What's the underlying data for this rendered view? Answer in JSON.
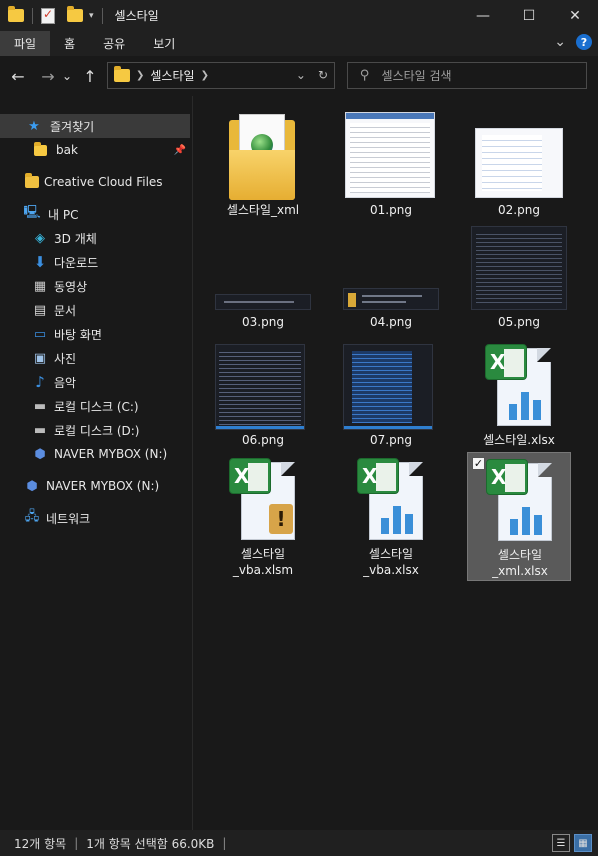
{
  "window": {
    "title": "셀스타일",
    "minimize": "—",
    "maximize": "☐",
    "close": "✕"
  },
  "ribbon": {
    "tabs": [
      "파일",
      "홈",
      "공유",
      "보기"
    ],
    "expand": "⌄",
    "help": "?"
  },
  "nav": {
    "back": "←",
    "forward": "→",
    "recent": "⌄",
    "up": "↑",
    "breadcrumb": "셀스타일",
    "refresh": "↻",
    "dropdown": "⌄",
    "search_placeholder": "셀스타일 검색"
  },
  "sidebar": {
    "items": [
      {
        "label": "즐겨찾기",
        "icon": "star-icon"
      },
      {
        "label": "bak",
        "icon": "folder-icon"
      },
      {
        "label": "Creative Cloud Files",
        "icon": "creative-cloud-icon"
      },
      {
        "label": "내 PC",
        "icon": "pc-icon"
      },
      {
        "label": "3D 개체",
        "icon": "cube-icon"
      },
      {
        "label": "다운로드",
        "icon": "download-icon"
      },
      {
        "label": "동영상",
        "icon": "video-icon"
      },
      {
        "label": "문서",
        "icon": "document-icon"
      },
      {
        "label": "바탕 화면",
        "icon": "desktop-icon"
      },
      {
        "label": "사진",
        "icon": "picture-icon"
      },
      {
        "label": "음악",
        "icon": "music-icon"
      },
      {
        "label": "로컬 디스크 (C:)",
        "icon": "drive-icon"
      },
      {
        "label": "로컬 디스크 (D:)",
        "icon": "drive-icon"
      },
      {
        "label": "NAVER MYBOX (N:)",
        "icon": "mybox-icon"
      },
      {
        "label": "NAVER MYBOX (N:)",
        "icon": "mybox-icon"
      },
      {
        "label": "네트워크",
        "icon": "network-icon"
      }
    ]
  },
  "files": [
    {
      "name": "셀스타일_xml",
      "type": "folder"
    },
    {
      "name": "01.png",
      "type": "png-light"
    },
    {
      "name": "02.png",
      "type": "png-light"
    },
    {
      "name": "03.png",
      "type": "png-dark"
    },
    {
      "name": "04.png",
      "type": "png-dark"
    },
    {
      "name": "05.png",
      "type": "png-dark"
    },
    {
      "name": "06.png",
      "type": "png-dark"
    },
    {
      "name": "07.png",
      "type": "png-dark"
    },
    {
      "name": "셀스타일.xlsx",
      "type": "xlsx"
    },
    {
      "name": "셀스타일\n_vba.xlsm",
      "type": "xlsm"
    },
    {
      "name": "셀스타일\n_vba.xlsx",
      "type": "xlsx"
    },
    {
      "name": "셀스타일\n_xml.xlsx",
      "type": "xlsx",
      "selected": true
    }
  ],
  "status": {
    "count": "12개 항목",
    "selection": "1개 항목 선택함 66.0KB"
  }
}
